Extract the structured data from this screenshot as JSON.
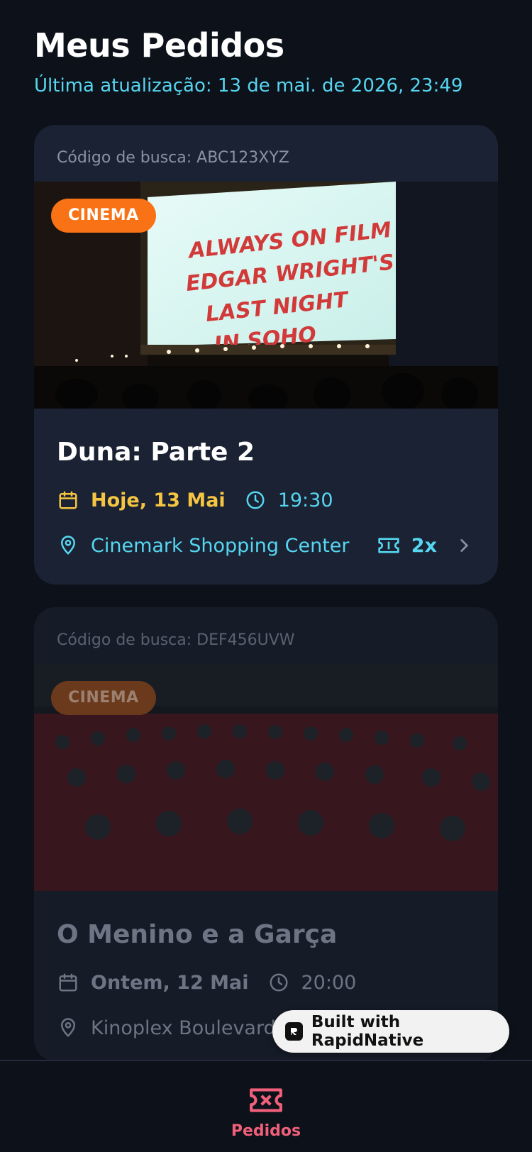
{
  "header": {
    "title": "Meus Pedidos",
    "subtitle": "Última atualização: 13 de mai. de 2026, 23:49"
  },
  "orders": [
    {
      "code": "Código de busca: ABC123XYZ",
      "badge": "CINEMA",
      "marquee": [
        "ALWAYS ON FILM",
        "EDGAR WRIGHT'S",
        "LAST NIGHT",
        "IN SOHO"
      ],
      "title": "Duna: Parte 2",
      "date": "Hoje, 13 Mai",
      "time": "19:30",
      "venue": "Cinemark Shopping Center",
      "quantity": "2x"
    },
    {
      "code": "Código de busca: DEF456UVW",
      "badge": "CINEMA",
      "title": "O Menino e a Garça",
      "date": "Ontem, 12 Mai",
      "time": "20:00",
      "venue": "Kinoplex Boulevard"
    }
  ],
  "built_with": "Built with RapidNative",
  "bottom_nav": {
    "tab_label": "Pedidos"
  },
  "colors": {
    "background": "#0d111a",
    "card": "#1a2233",
    "accent_cyan": "#56d6f0",
    "accent_yellow": "#f5c542",
    "badge_orange": "#f97316",
    "tab_active": "#f0607a"
  }
}
